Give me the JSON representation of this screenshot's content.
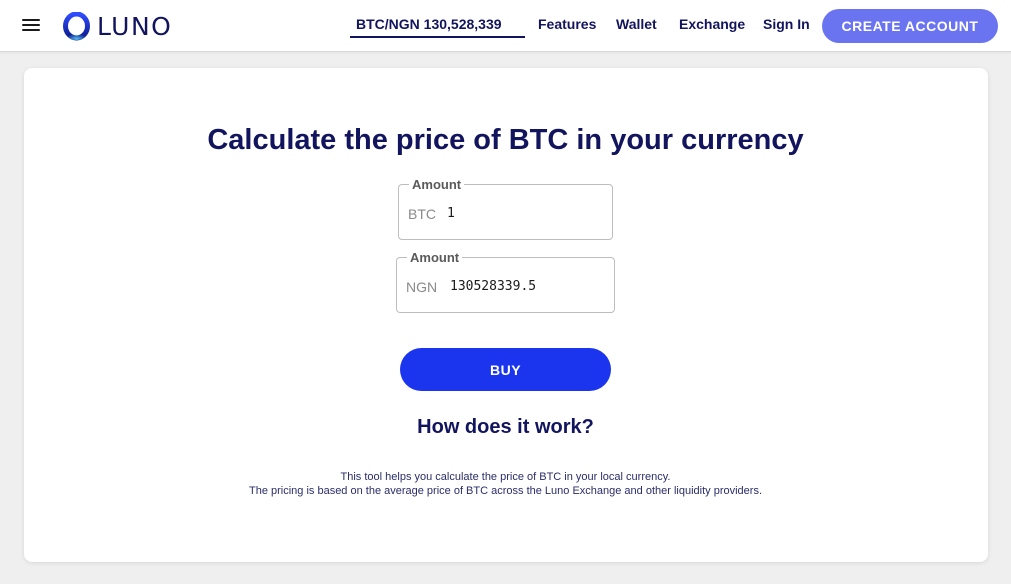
{
  "brand": {
    "name": "LUNO",
    "accent": "#12155e",
    "logo_color": "#1b35ee"
  },
  "nav": {
    "ticker": "BTC/NGN 130,528,339",
    "items": [
      "Features",
      "Wallet",
      "Exchange",
      "Sign In"
    ],
    "cta": "CREATE ACCOUNT"
  },
  "main": {
    "title": "Calculate the price of BTC in your currency",
    "btc_field": {
      "label": "Amount",
      "currency": "BTC",
      "value": "1"
    },
    "ngn_field": {
      "label": "Amount",
      "currency": "NGN",
      "value": "130528339.5"
    },
    "buy_label": "BUY",
    "how_title": "How does it work?",
    "description": [
      "This tool helps you calculate the price of BTC in your local currency.",
      "The pricing is based on the average price of BTC across the Luno Exchange and other liquidity providers."
    ]
  },
  "colors": {
    "cta_bg": "#6b74f0",
    "buy_bg": "#1b35ee",
    "page_bg": "#efefef"
  }
}
